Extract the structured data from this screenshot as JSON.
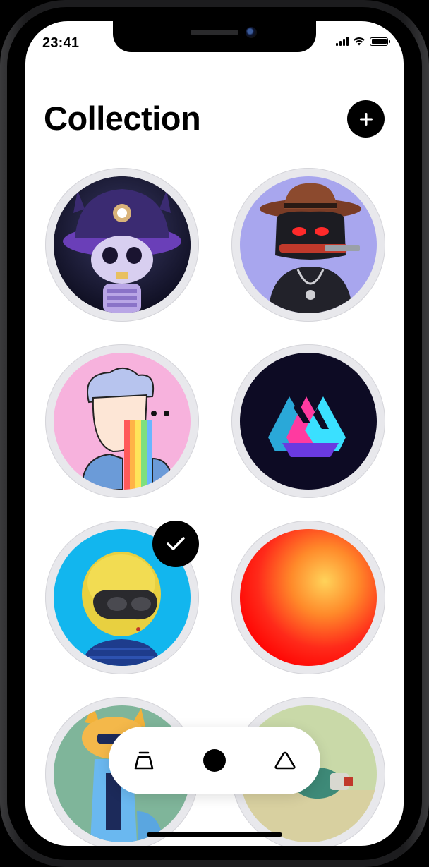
{
  "status_bar": {
    "time": "23:41"
  },
  "header": {
    "title": "Collection",
    "add_icon": "plus-icon"
  },
  "collection": {
    "items": [
      {
        "name": "skeleton-cap-nft",
        "selected": false
      },
      {
        "name": "cowboy-knife-nft",
        "selected": false
      },
      {
        "name": "rainbow-boy-nft",
        "selected": false
      },
      {
        "name": "impossible-triangle-nft",
        "selected": false
      },
      {
        "name": "yellow-helmet-nft",
        "selected": true
      },
      {
        "name": "red-orange-gradient-nft",
        "selected": false
      },
      {
        "name": "cat-robot-nft",
        "selected": false
      },
      {
        "name": "green-figure-nft",
        "selected": false
      }
    ]
  },
  "tabbar": {
    "tabs": [
      {
        "icon": "bag-icon"
      },
      {
        "icon": "circle-icon"
      },
      {
        "icon": "triangle-icon"
      }
    ]
  },
  "colors": {
    "accent": "#000000",
    "background": "#ffffff",
    "ring": "#e8e8ec"
  }
}
